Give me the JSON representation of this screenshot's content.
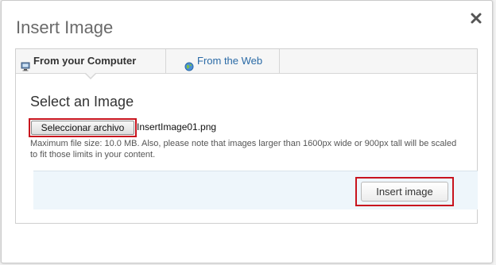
{
  "dialog": {
    "title": "Insert Image",
    "close_icon": "close-icon"
  },
  "tabs": [
    {
      "label": "From your Computer",
      "icon": "computer-icon",
      "active": true
    },
    {
      "label": "From the Web",
      "icon": "globe-icon",
      "active": false
    }
  ],
  "upload": {
    "section_title": "Select an Image",
    "choose_file_label": "Seleccionar archivo",
    "file_name": "InsertImage01.png",
    "help_text": "Maximum file size: 10.0 MB. Also, please note that images larger than 1600px wide or 900px tall will be scaled to fit those limits in your content."
  },
  "actions": {
    "insert_label": "Insert image"
  },
  "colors": {
    "highlight": "#c8141e",
    "link": "#2a6aa6",
    "action_bar_bg": "#eef6fb"
  }
}
